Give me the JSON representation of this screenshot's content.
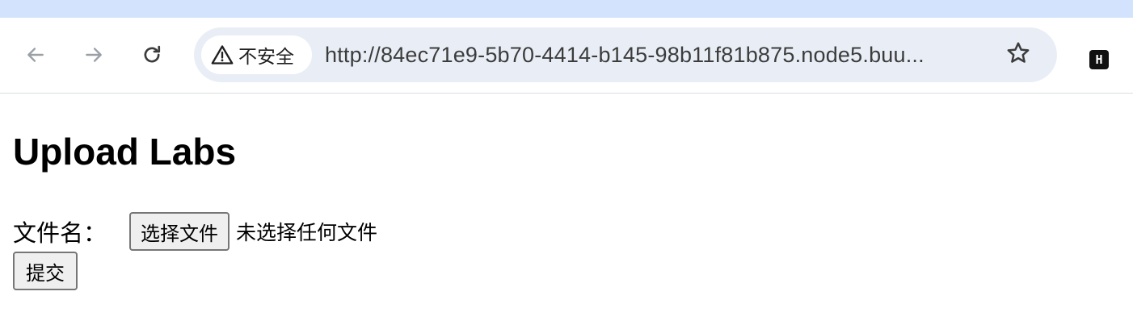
{
  "browser": {
    "security_label": "不安全",
    "security_icon": "warning-triangle-icon",
    "url": "http://84ec71e9-5b70-4414-b145-98b11f81b875.node5.buu...",
    "back_icon": "back-arrow-icon",
    "forward_icon": "forward-arrow-icon",
    "reload_icon": "reload-icon",
    "bookmark_icon": "star-icon",
    "extension_label": "H",
    "tabstrip_color": "#d3e3fd",
    "omnibox_color": "#e9eef6"
  },
  "page": {
    "title": "Upload Labs",
    "form": {
      "file_label": "文件名：",
      "file_button": "选择文件",
      "file_status": "未选择任何文件",
      "submit_button": "提交"
    }
  }
}
